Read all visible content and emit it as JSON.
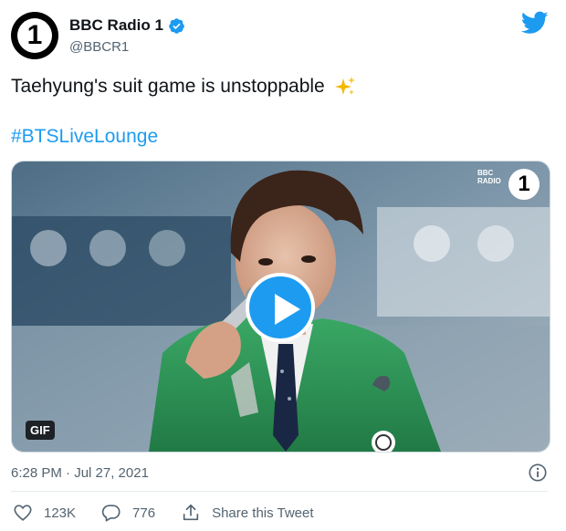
{
  "tweet": {
    "author": {
      "display_name": "BBC Radio 1",
      "handle": "@BBCR1",
      "avatar_glyph": "1",
      "verified": true
    },
    "text": "Taehyung's suit game is unstoppable",
    "hashtag": "#BTSLiveLounge",
    "media": {
      "badge": "GIF",
      "watermark_line1": "BBC",
      "watermark_line2": "RADIO",
      "watermark_number": "1",
      "play_icon": "play-icon"
    },
    "timestamp": "6:28 PM · Jul 27, 2021",
    "likes": "123K",
    "replies": "776",
    "share_label": "Share this Tweet"
  },
  "colors": {
    "twitter_blue": "#1d9bf0",
    "text": "#0f1419",
    "muted": "#536471",
    "jacket_green": "#2f9a5a"
  },
  "icons": [
    "verified-badge-icon",
    "twitter-bird-icon",
    "sparkles-icon",
    "info-icon",
    "heart-icon",
    "reply-icon",
    "share-icon"
  ]
}
